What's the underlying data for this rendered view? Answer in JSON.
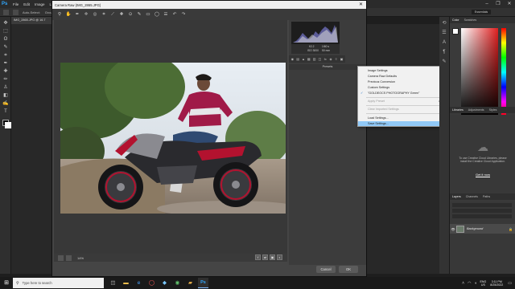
{
  "photoshop": {
    "logo": "Ps",
    "menu": [
      "File",
      "Edit",
      "Image",
      "Layer",
      "Type",
      "Select",
      "Filter",
      "3D",
      "View",
      "Window",
      "Help"
    ],
    "options_bar": [
      "Auto-Select:",
      "Group"
    ],
    "workspace": "Essentials",
    "doc_tab": "IMG_2865.JPG @ 16.7",
    "window_controls": [
      "–",
      "❐",
      "✕"
    ]
  },
  "camera_raw": {
    "title": "Camera Raw (IMG_2865.JPG)",
    "close_glyph": "✕",
    "camera_info": {
      "aperture": "f/2.2",
      "shutter": "1/60 s",
      "iso": "ISO 3000",
      "focal": "50 mm"
    },
    "presets_header": "Presets",
    "zoom": "14%",
    "cancel_label": "Cancel",
    "ok_label": "OK"
  },
  "context_menu": {
    "items": [
      {
        "label": "Image Settings",
        "state": "normal"
      },
      {
        "label": "Camera Raw Defaults",
        "state": "normal"
      },
      {
        "label": "Previous Conversion",
        "state": "normal"
      },
      {
        "label": "Custom Settings",
        "state": "normal"
      },
      {
        "label": "\"GOLDEOCS PHOTOGRAPHY Green\"",
        "state": "checked"
      },
      {
        "label": "Apply Preset",
        "state": "disabled"
      },
      {
        "label": "Clear Imported Settings",
        "state": "disabled"
      },
      {
        "label": "Load Settings...",
        "state": "normal"
      },
      {
        "label": "Save Settings...",
        "state": "selected"
      }
    ],
    "check_glyph": "✓",
    "submenu_glyph": "▸"
  },
  "panels": {
    "color_tabs": [
      "Color",
      "Swatches"
    ],
    "library_tabs": [
      "Libraries",
      "Adjustments",
      "Styles"
    ],
    "library_message": "To use Creative Cloud Libraries, please install the Creative Cloud Application.",
    "library_link": "Get it now",
    "layers_tabs": [
      "Layers",
      "Channels",
      "Paths"
    ],
    "layer_name": "Background"
  },
  "taskbar": {
    "search_placeholder": "Type here to search",
    "lang_line1": "ENG",
    "lang_line2": "US",
    "time": "3:11 PM",
    "date": "8/25/2022"
  }
}
